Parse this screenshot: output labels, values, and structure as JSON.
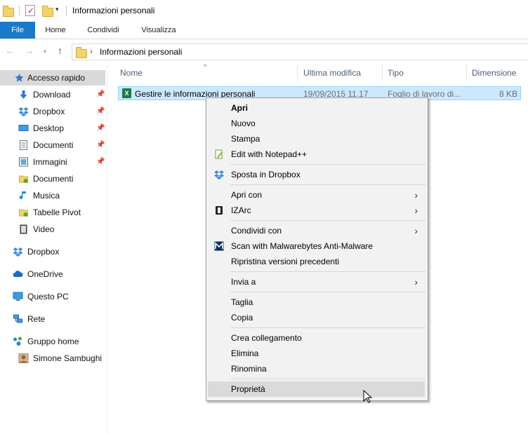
{
  "window": {
    "title": "Informazioni personali",
    "quick_access_dropdown": "▾"
  },
  "ribbon": {
    "tabs": [
      {
        "label": "File"
      },
      {
        "label": "Home"
      },
      {
        "label": "Condividi"
      },
      {
        "label": "Visualizza"
      }
    ]
  },
  "address": {
    "separator": "›",
    "path": "Informazioni personali"
  },
  "sidebar": {
    "items": [
      {
        "label": "Accesso rapido",
        "icon": "star-icon"
      },
      {
        "label": "Download",
        "icon": "download-icon",
        "pinned": true
      },
      {
        "label": "Dropbox",
        "icon": "dropbox-icon",
        "pinned": true
      },
      {
        "label": "Desktop",
        "icon": "desktop-icon",
        "pinned": true
      },
      {
        "label": "Documenti",
        "icon": "documents-icon",
        "pinned": true
      },
      {
        "label": "Immagini",
        "icon": "pictures-icon",
        "pinned": true
      },
      {
        "label": "Documenti",
        "icon": "documents-sync-icon"
      },
      {
        "label": "Musica",
        "icon": "music-icon"
      },
      {
        "label": "Tabelle Pivot",
        "icon": "pivot-icon"
      },
      {
        "label": "Video",
        "icon": "video-icon"
      },
      {
        "label": "Dropbox",
        "icon": "dropbox-icon"
      },
      {
        "label": "OneDrive",
        "icon": "onedrive-icon"
      },
      {
        "label": "Questo PC",
        "icon": "computer-icon"
      },
      {
        "label": "Rete",
        "icon": "network-icon"
      },
      {
        "label": "Gruppo home",
        "icon": "homegroup-icon"
      },
      {
        "label": "Simone Sambughi",
        "icon": "user-icon"
      }
    ]
  },
  "file_list": {
    "columns": [
      {
        "label": "Nome"
      },
      {
        "label": "Ultima modifica"
      },
      {
        "label": "Tipo"
      },
      {
        "label": "Dimensione"
      }
    ],
    "rows": [
      {
        "name": "Gestire le informazioni personali",
        "modified": "19/09/2015 11.17",
        "type": "Foglio di lavoro di...",
        "size": "8 KB"
      }
    ]
  },
  "context_menu": {
    "items": [
      {
        "label": "Apri",
        "bold": true
      },
      {
        "label": "Nuovo"
      },
      {
        "label": "Stampa"
      },
      {
        "label": "Edit with Notepad++",
        "icon": "notepadpp-icon"
      },
      {
        "label": "Sposta in Dropbox",
        "icon": "dropbox-icon"
      },
      {
        "label": "Apri con",
        "submenu": true
      },
      {
        "label": "IZArc",
        "icon": "izarc-icon",
        "submenu": true
      },
      {
        "label": "Condividi con",
        "submenu": true
      },
      {
        "label": "Scan with Malwarebytes Anti-Malware",
        "icon": "malwarebytes-icon"
      },
      {
        "label": "Ripristina versioni precedenti"
      },
      {
        "label": "Invia a",
        "submenu": true
      },
      {
        "label": "Taglia"
      },
      {
        "label": "Copia"
      },
      {
        "label": "Crea collegamento"
      },
      {
        "label": "Elimina"
      },
      {
        "label": "Rinomina"
      },
      {
        "label": "Proprietà",
        "hover": true
      }
    ],
    "submenu_arrow": "›"
  },
  "colors": {
    "file_tab": "#1979ca",
    "selection": "#cce8ff",
    "sidebar_selected": "#d9d9d9",
    "menu_bg": "#f2f2f2"
  }
}
